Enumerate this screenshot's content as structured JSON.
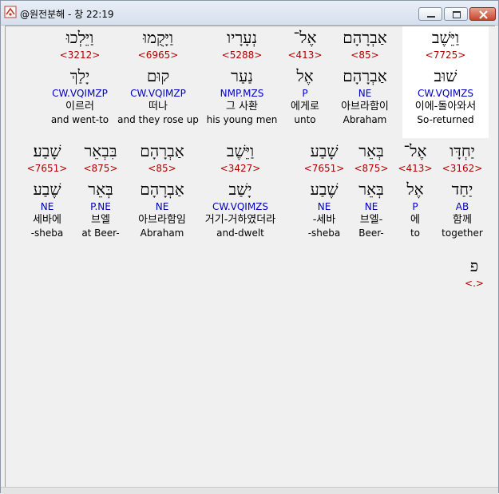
{
  "window": {
    "title": "@원전분해 - 창 22:19"
  },
  "rows": [
    {
      "words": [
        {
          "heb": "וַיֵּשֶׁב",
          "num": "<7725>",
          "lemma": "שׁוּב",
          "parse": "CW.VQIMZS",
          "kor": "이에-돌아와서",
          "eng": "So-returned",
          "selected": true
        },
        {
          "heb": "אַבְרָהָם",
          "num": "<85>",
          "lemma": "אַבְרָהָם",
          "parse": "NE",
          "kor": "아브라함이",
          "eng": "Abraham"
        },
        {
          "heb": "אֶל־",
          "num": "<413>",
          "lemma": "אֶל",
          "parse": "P",
          "kor": "에게로",
          "eng": "unto"
        },
        {
          "heb": "נְעָרָיו",
          "num": "<5288>",
          "lemma": "נַעַר",
          "parse": "NMP.MZS",
          "kor": "그 사환",
          "eng": "his young men"
        },
        {
          "heb": "וַיָּקֻמוּ",
          "num": "<6965>",
          "lemma": "קוּם",
          "parse": "CW.VQIMZP",
          "kor": "떠나",
          "eng": "and they rose up"
        },
        {
          "heb": "וַיֵּלְכוּ",
          "num": "<3212>",
          "lemma": "יָלַךְ",
          "parse": "CW.VQIMZP",
          "kor": "이르러",
          "eng": "and went-to"
        }
      ]
    },
    {
      "words": [
        {
          "heb": "יַחְדָּו",
          "num": "<3162>",
          "lemma": "יַחַד",
          "parse": "AB",
          "kor": "함께",
          "eng": "together"
        },
        {
          "heb": "אֶל־",
          "num": "<413>",
          "lemma": "אֶל",
          "parse": "P",
          "kor": "에",
          "eng": "to"
        },
        {
          "heb": "בְּאֵר",
          "num": "<875>",
          "lemma": "בְּאֵר",
          "parse": "NE",
          "kor": "브엘-",
          "eng": "Beer-"
        },
        {
          "heb": "שָׁבַע",
          "num": "<7651>",
          "lemma": "שֶׁבַע",
          "parse": "NE",
          "kor": "-세바",
          "eng": "-sheba"
        },
        {
          "heb": "וַיֵּשֶׁב",
          "num": "<3427>",
          "lemma": "יָשַׁב",
          "parse": "CW.VQIMZS",
          "kor": "거기-거하였더라",
          "eng": "and-dwelt"
        },
        {
          "heb": "אַבְרָהָם",
          "num": "<85>",
          "lemma": "אַבְרָהָם",
          "parse": "NE",
          "kor": "아브라함임",
          "eng": "Abraham"
        },
        {
          "heb": "בִּבְאֵר",
          "num": "<875>",
          "lemma": "בְּאֵר",
          "parse": "P.NE",
          "kor": "브엘",
          "eng": "at Beer-"
        },
        {
          "heb": "שָׁבַע׃",
          "num": "<7651>",
          "lemma": "שֶׁבַע",
          "parse": "NE",
          "kor": "세바에",
          "eng": "-sheba"
        }
      ]
    },
    {
      "words": [
        {
          "heb": "פ",
          "num": "<.>"
        }
      ]
    }
  ]
}
